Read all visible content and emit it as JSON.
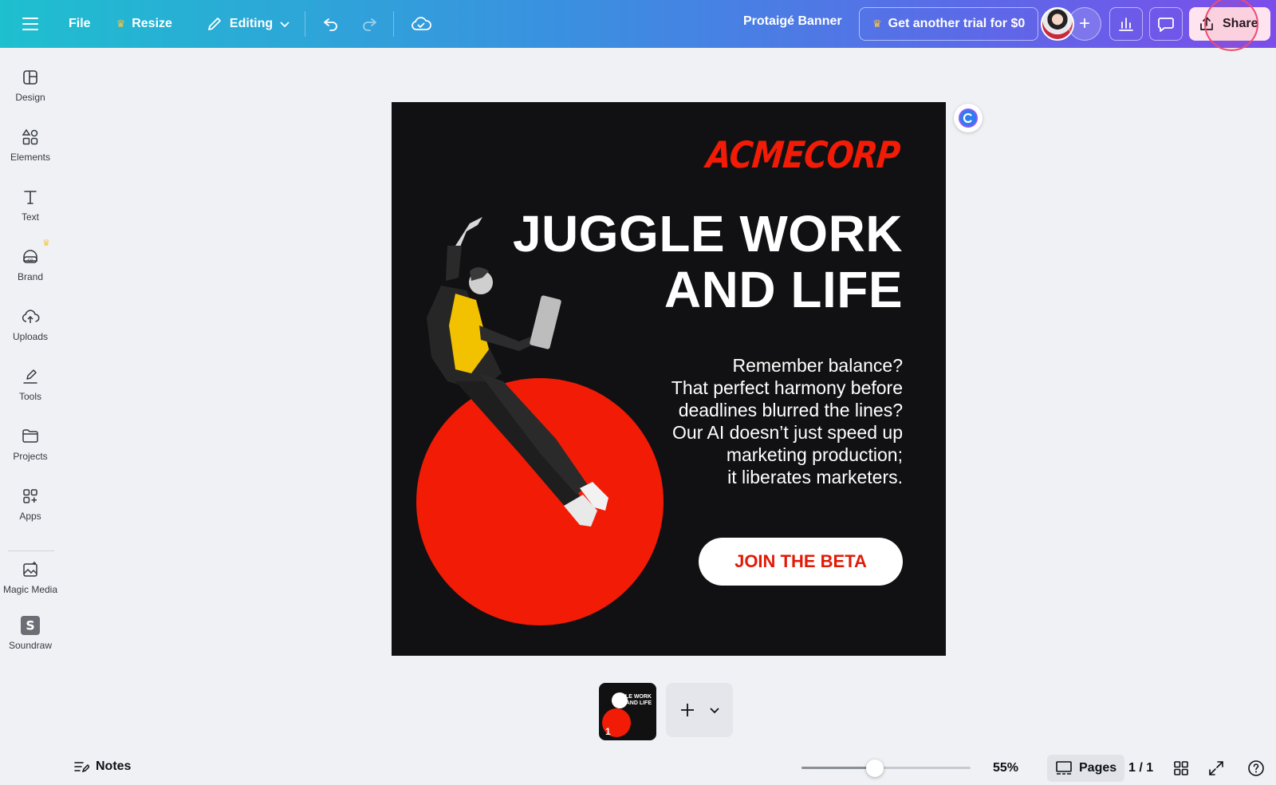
{
  "topbar": {
    "file_label": "File",
    "resize_label": "Resize",
    "editing_label": "Editing",
    "doc_title": "Protaigé Banner",
    "trial_label": "Get another trial for $0",
    "share_label": "Share"
  },
  "sidebar": {
    "items": [
      {
        "label": "Design",
        "icon": "layout-icon"
      },
      {
        "label": "Elements",
        "icon": "shapes-icon"
      },
      {
        "label": "Text",
        "icon": "text-icon"
      },
      {
        "label": "Brand",
        "icon": "brand-icon"
      },
      {
        "label": "Uploads",
        "icon": "cloud-upload-icon"
      },
      {
        "label": "Tools",
        "icon": "pen-icon"
      },
      {
        "label": "Projects",
        "icon": "folder-icon"
      },
      {
        "label": "Apps",
        "icon": "apps-icon"
      },
      {
        "label": "Magic Media",
        "icon": "magic-media-icon"
      },
      {
        "label": "Soundraw",
        "icon": "soundraw-icon"
      }
    ]
  },
  "design": {
    "logo": "ACMECORP",
    "headline_line1": "JUGGLE WORK",
    "headline_line2": "AND LIFE",
    "body_lines": [
      "Remember balance?",
      "That perfect harmony before",
      "deadlines blurred the lines?",
      "Our AI doesn’t just speed up",
      "marketing production;",
      "it liberates marketers."
    ],
    "cta_label": "JOIN THE BETA",
    "colors": {
      "background": "#111113",
      "accent": "#f21b06",
      "text": "#ffffff"
    }
  },
  "pages": {
    "thumb_number": "1",
    "thumb_text": "LE WORK AND LIFE"
  },
  "bottombar": {
    "notes_label": "Notes",
    "zoom_value": "55%",
    "zoom_level": 55,
    "pages_label": "Pages",
    "page_count": "1 / 1"
  }
}
